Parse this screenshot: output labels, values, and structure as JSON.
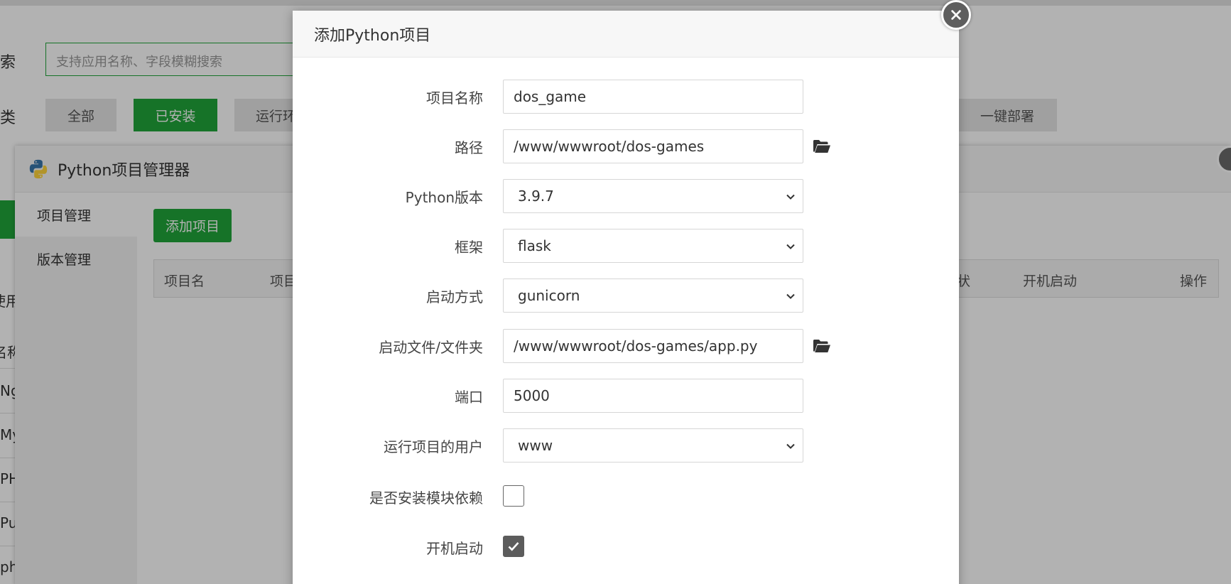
{
  "background": {
    "search_label": "搜索",
    "search_placeholder": "支持应用名称、字段模糊搜索",
    "category_label": "分类",
    "categories": [
      "全部",
      "已安装",
      "运行环",
      "一键部署"
    ],
    "left_list": [
      "使用",
      "名称",
      "Ng",
      "My",
      "PH",
      "Pu",
      "ph"
    ]
  },
  "manager": {
    "title": "Python项目管理器",
    "sidebar": [
      "项目管理",
      "版本管理"
    ],
    "add_button": "添加项目",
    "table_headers": [
      "项目名",
      "项目",
      "状",
      "开机启动",
      "操作"
    ]
  },
  "modal": {
    "title": "添加Python项目",
    "fields": {
      "name": {
        "label": "项目名称",
        "value": "dos_game"
      },
      "path": {
        "label": "路径",
        "value": "/www/wwwroot/dos-games"
      },
      "python_version": {
        "label": "Python版本",
        "value": "3.9.7"
      },
      "framework": {
        "label": "框架",
        "value": "flask"
      },
      "start_method": {
        "label": "启动方式",
        "value": "gunicorn"
      },
      "start_file": {
        "label": "启动文件/文件夹",
        "value": "/www/wwwroot/dos-games/app.py"
      },
      "port": {
        "label": "端口",
        "value": "5000"
      },
      "run_user": {
        "label": "运行项目的用户",
        "value": "www"
      },
      "install_deps": {
        "label": "是否安装模块依赖",
        "checked": false
      },
      "autostart": {
        "label": "开机启动",
        "checked": true
      }
    }
  },
  "colors": {
    "accent": "#20a53a",
    "overlay": "rgba(0,0,0,0.30)"
  },
  "icons": {
    "close": "close-icon",
    "folder": "folder-open-icon",
    "chevron": "chevron-down-icon",
    "check": "check-icon",
    "python": "python-logo-icon"
  }
}
